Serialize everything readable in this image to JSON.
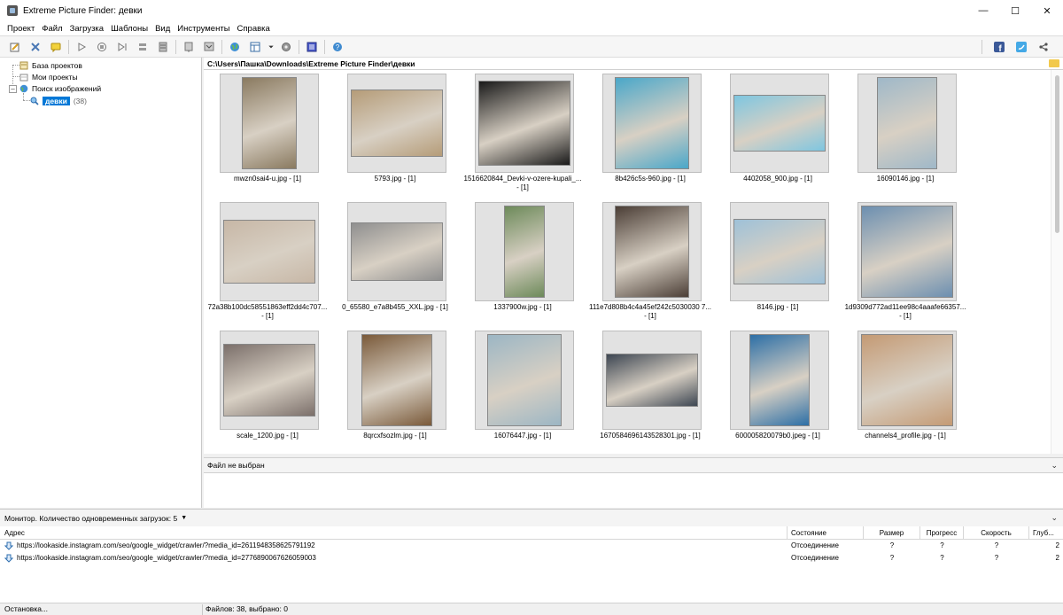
{
  "window": {
    "title": "Extreme Picture Finder: девки"
  },
  "menu": [
    "Проект",
    "Файл",
    "Загрузка",
    "Шаблоны",
    "Вид",
    "Инструменты",
    "Справка"
  ],
  "toolbar": {
    "left_icons": [
      "edit-icon",
      "tools-icon",
      "comment-icon",
      "play-icon",
      "stop-icon",
      "play-next-icon",
      "stack-icon",
      "list-icon",
      "template-icon",
      "templates-icon",
      "globe-icon",
      "grid-icon",
      "settings-icon",
      "monitor-icon",
      "help-icon"
    ],
    "right_icons": [
      "facebook-icon",
      "twitter-icon",
      "share-icon"
    ]
  },
  "tree": {
    "items": [
      {
        "label": "База проектов",
        "icon": "database-icon"
      },
      {
        "label": "Мои проекты",
        "icon": "folder-icon"
      },
      {
        "label": "Поиск изображений",
        "icon": "globe-icon"
      },
      {
        "label": "девки",
        "count": "(38)",
        "icon": "search-icon"
      }
    ]
  },
  "path": "C:\\Users\\Пашка\\Downloads\\Extreme Picture Finder\\девки",
  "gallery": {
    "items": [
      {
        "line1": "mwzn0sai4-u.jpg - [1]",
        "line2": "",
        "color": "#8a7a60"
      },
      {
        "line1": "5793.jpg - [1]",
        "line2": "",
        "color": "#b59c78"
      },
      {
        "line1": "1516620844_Devki-v-ozere-kupali_...",
        "line2": "- [1]",
        "color": "#1a1a1a"
      },
      {
        "line1": "8b426c5s-960.jpg - [1]",
        "line2": "",
        "color": "#4aa7c9"
      },
      {
        "line1": "4402058_900.jpg - [1]",
        "line2": "",
        "color": "#7ec6e0"
      },
      {
        "line1": "16090146.jpg - [1]",
        "line2": "",
        "color": "#9fb8c8"
      },
      {
        "line1": "72a38b100dc58551863eff2dd4c707...",
        "line2": "- [1]",
        "color": "#c7b7a6"
      },
      {
        "line1": "0_65580_e7a8b455_XXL.jpg - [1]",
        "line2": "",
        "color": "#8f8f8f"
      },
      {
        "line1": "1337900w.jpg - [1]",
        "line2": "",
        "color": "#6d8a5a"
      },
      {
        "line1": "111e7d808b4c4a45ef242c5030030 7...",
        "line2": "- [1]",
        "color": "#4b3e36"
      },
      {
        "line1": "8146.jpg - [1]",
        "line2": "",
        "color": "#9ec1d8"
      },
      {
        "line1": "1d9309d772ad11ee98c4aaafe66357...",
        "line2": "- [1]",
        "color": "#6c8fb0"
      },
      {
        "line1": "scale_1200.jpg - [1]",
        "line2": "",
        "color": "#7b6f6a"
      },
      {
        "line1": "8qrcxfsozlm.jpg - [1]",
        "line2": "",
        "color": "#7a5a3a"
      },
      {
        "line1": "16076447.jpg - [1]",
        "line2": "",
        "color": "#9cb6c4"
      },
      {
        "line1": "1670584696143528301.jpg - [1]",
        "line2": "",
        "color": "#3d4652"
      },
      {
        "line1": "600005820079b0.jpeg - [1]",
        "line2": "",
        "color": "#2d6fa6"
      },
      {
        "line1": "channels4_profile.jpg - [1]",
        "line2": "",
        "color": "#c49a74"
      }
    ]
  },
  "info": {
    "label": "Файл не выбран"
  },
  "monitor": {
    "label": "Монитор. Количество одновременных загрузок: 5"
  },
  "downloads": {
    "columns": [
      "Адрес",
      "Состояние",
      "Размер",
      "Прогресс",
      "Скорость",
      "Глуб..."
    ],
    "rows": [
      {
        "address": "https://lookaside.instagram.com/seo/google_widget/crawler/?media_id=2611948358625791192",
        "state": "Отсоединение",
        "size": "?",
        "progress": "?",
        "speed": "?",
        "depth": "2"
      },
      {
        "address": "https://lookaside.instagram.com/seo/google_widget/crawler/?media_id=2776890067626059003",
        "state": "Отсоединение",
        "size": "?",
        "progress": "?",
        "speed": "?",
        "depth": "2"
      }
    ]
  },
  "status": {
    "left": "Остановка...",
    "right": "Файлов: 38, выбрано: 0"
  }
}
